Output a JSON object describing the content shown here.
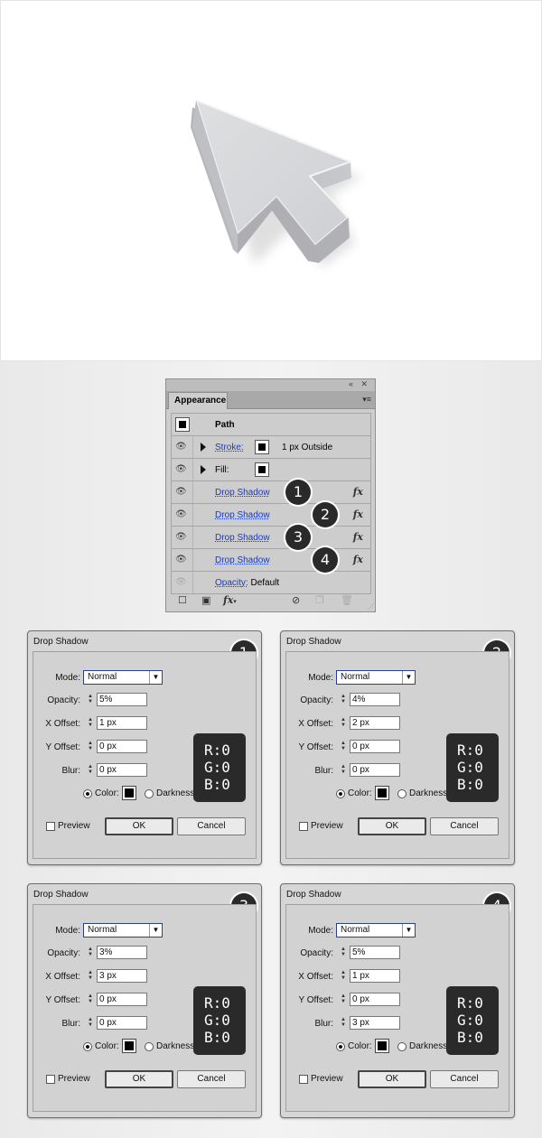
{
  "appearance_panel": {
    "tab_label": "Appearance",
    "rows": [
      {
        "label": "Path"
      },
      {
        "label": "Stroke:",
        "value": "1 px  Outside"
      },
      {
        "label": "Fill:"
      },
      {
        "label": "Drop Shadow",
        "badge": "1"
      },
      {
        "label": "Drop Shadow",
        "badge": "2"
      },
      {
        "label": "Drop Shadow",
        "badge": "3"
      },
      {
        "label": "Drop Shadow",
        "badge": "4"
      },
      {
        "label": "Opacity:",
        "value": "Default"
      }
    ],
    "fx_label": "fx"
  },
  "dialogs": [
    {
      "title": "Drop Shadow",
      "badge": "1",
      "mode": "Normal",
      "opacity": "5%",
      "x_offset": "1 px",
      "y_offset": "0 px",
      "blur": "0 px",
      "rgb": {
        "r": "R:0",
        "g": "G:0",
        "b": "B:0"
      }
    },
    {
      "title": "Drop Shadow",
      "badge": "2",
      "mode": "Normal",
      "opacity": "4%",
      "x_offset": "2 px",
      "y_offset": "0 px",
      "blur": "0 px",
      "rgb": {
        "r": "R:0",
        "g": "G:0",
        "b": "B:0"
      }
    },
    {
      "title": "Drop Shadow",
      "badge": "3",
      "mode": "Normal",
      "opacity": "3%",
      "x_offset": "3 px",
      "y_offset": "0 px",
      "blur": "0 px",
      "rgb": {
        "r": "R:0",
        "g": "G:0",
        "b": "B:0"
      }
    },
    {
      "title": "Drop Shadow",
      "badge": "4",
      "mode": "Normal",
      "opacity": "5%",
      "x_offset": "1 px",
      "y_offset": "0 px",
      "blur": "3 px",
      "rgb": {
        "r": "R:0",
        "g": "G:0",
        "b": "B:0"
      }
    }
  ],
  "dialog_labels": {
    "mode": "Mode:",
    "opacity": "Opacity:",
    "x_offset": "X Offset:",
    "y_offset": "Y Offset:",
    "blur": "Blur:",
    "color": "Color:",
    "darkness": "Darkness",
    "preview": "Preview",
    "ok": "OK",
    "cancel": "Cancel"
  },
  "colors": {
    "link": "#1a3bbf",
    "badge": "#2a2a2a",
    "dialog_bg": "#d6d6d6"
  }
}
